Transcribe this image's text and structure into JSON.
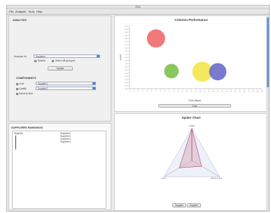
{
  "window": {
    "title": "SMA"
  },
  "menu": [
    "File",
    "Analysis",
    "Tools",
    "Help"
  ],
  "left": {
    "section1_title": "ANALYSIS",
    "row_label": "Analysis for",
    "row_value": "Suppliers",
    "check1_label": "Bubble",
    "check2_label": "Select all grouped",
    "update_button": "Update",
    "components_title": "COMPONENTS",
    "components": [
      {
        "label": "Cost",
        "value": "Supplier1"
      },
      {
        "label": "Quality",
        "value": "Supplier2"
      },
      {
        "label": "Delivery time",
        "value": ""
      }
    ],
    "suppliers_title": "SUPPLIERS RANKINGS",
    "suppliers_header": "Supplier",
    "suppliers_rank_header": "Supplier1",
    "supplier_list": [
      "Supplier2",
      "Supplier3",
      "Supplier4"
    ]
  },
  "bubble_chart": {
    "title": "Criterion Performance",
    "ylabel": "Quality",
    "xlabel": "Cost (days)",
    "scroll_label": "Cost",
    "colors": [
      "#ee6a6a",
      "#7cc24a",
      "#f3e54a",
      "#6a6ccb"
    ],
    "chart_data": {
      "type": "scatter",
      "title": "Criterion Performance",
      "xlabel": "Cost (days)",
      "ylabel": "Quality",
      "xlim": [
        0,
        30
      ],
      "ylim": [
        0,
        1
      ],
      "points": [
        {
          "x": 6.0,
          "y": 0.8,
          "size": 1.0
        },
        {
          "x": 9.5,
          "y": 0.28,
          "size": 0.8
        },
        {
          "x": 16.5,
          "y": 0.27,
          "size": 1.1
        },
        {
          "x": 20.0,
          "y": 0.27,
          "size": 0.95
        }
      ]
    }
  },
  "spider_chart": {
    "title": "Spider Chart",
    "axes": [
      "Quality",
      "Delivery time",
      "Cost"
    ],
    "button_left": "Supplier",
    "button_right": "Supplier",
    "chart_data": {
      "type": "radar",
      "title": "Spider Chart",
      "axes": [
        "Quality",
        "Delivery time",
        "Cost"
      ],
      "series": [
        {
          "values": [
            1.0,
            0.35,
            0.45
          ]
        }
      ]
    }
  }
}
